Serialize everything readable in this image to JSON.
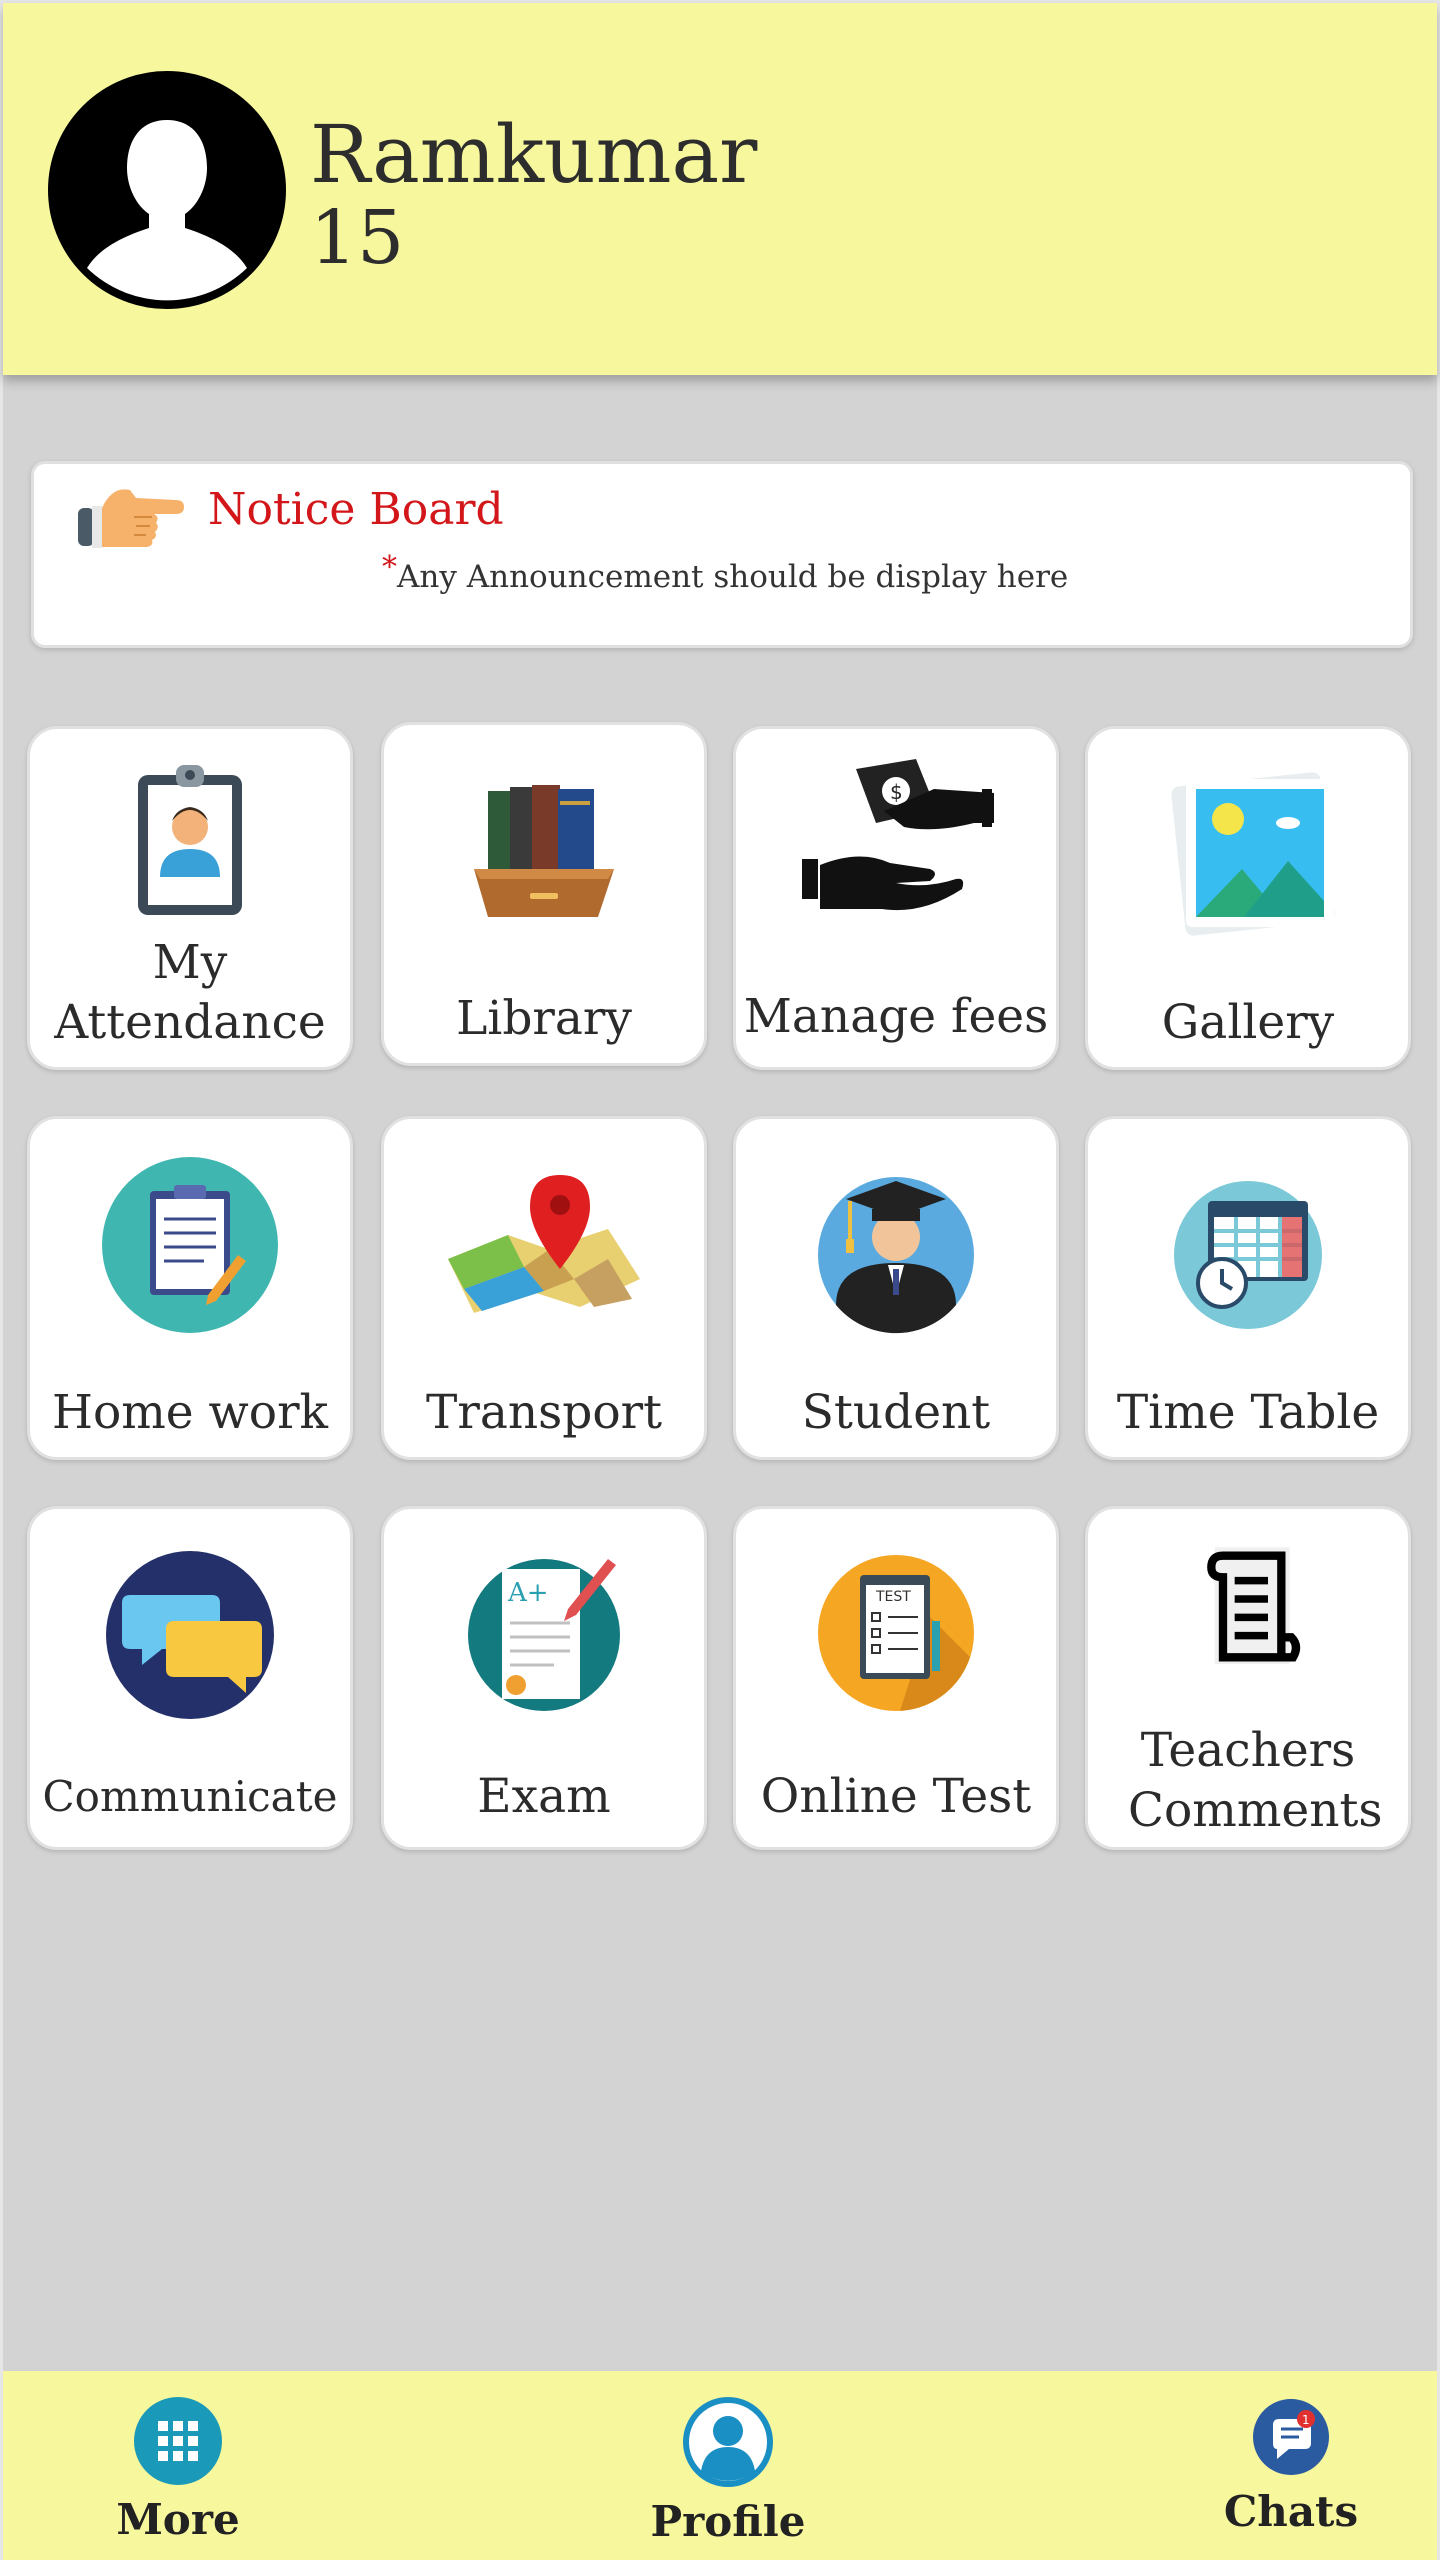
{
  "header": {
    "name": "Ramkumar",
    "id_number": "15",
    "avatar_icon": "user-silhouette-icon"
  },
  "notice": {
    "title": "Notice Board",
    "star": "*",
    "text": "Any Announcement should be display here",
    "icon": "pointing-hand-icon"
  },
  "tiles": [
    {
      "label": "My Attendance",
      "icon": "attendance-badge-icon"
    },
    {
      "label": "Library",
      "icon": "books-icon"
    },
    {
      "label": "Manage fees",
      "icon": "money-hands-icon"
    },
    {
      "label": "Gallery",
      "icon": "picture-icon"
    },
    {
      "label": "Home work",
      "icon": "clipboard-icon"
    },
    {
      "label": "Transport",
      "icon": "map-pin-icon"
    },
    {
      "label": "Student",
      "icon": "graduate-icon"
    },
    {
      "label": "Time Table",
      "icon": "calendar-clock-icon"
    },
    {
      "label": "Communicate",
      "icon": "chat-bubbles-icon"
    },
    {
      "label": "Exam",
      "icon": "exam-paper-icon"
    },
    {
      "label": "Online Test",
      "icon": "test-clipboard-icon"
    },
    {
      "label": "Teachers Comments",
      "icon": "scroll-icon"
    }
  ],
  "bottom_nav": {
    "more": "More",
    "profile": "Profile",
    "chats": "Chats",
    "chats_badge": "1"
  },
  "colors": {
    "header_bg": "#f7f79e",
    "background": "#d3d3d3",
    "notice_title": "#d2161a",
    "nav_blue": "#1a8fc4"
  }
}
